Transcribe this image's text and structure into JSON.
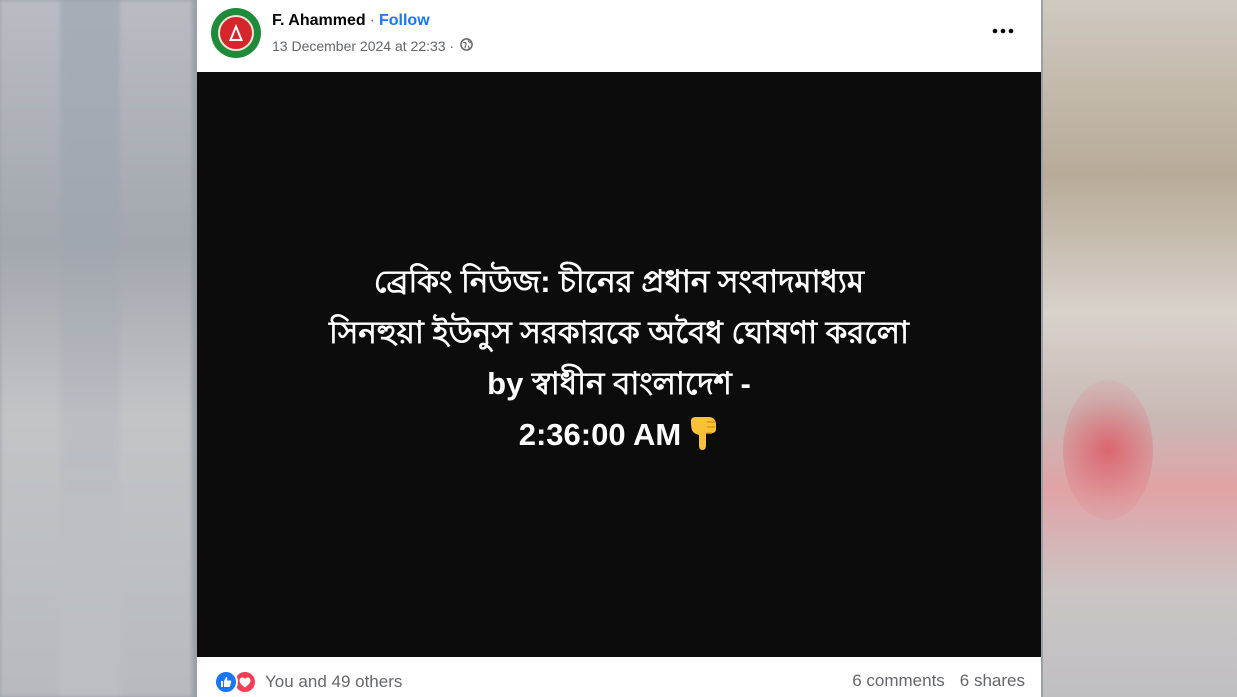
{
  "post": {
    "author": "F. Ahammed",
    "separator": "·",
    "follow_label": "Follow",
    "timestamp": "13 December 2024 at 22:33 ·",
    "audience_icon": "globe-icon",
    "more_icon": "more-options-icon"
  },
  "media": {
    "lines": [
      "ব্রেকিং নিউজ: চীনের প্রধান সংবাদমাধ্যম",
      "সিনহুয়া ইউনুস সরকারকে অবৈধ ঘোষণা করলো",
      "by স্বাধীন বাংলাদেশ -",
      "2:36:00 AM"
    ],
    "emoji_icon": "pointing-down-hand-icon"
  },
  "engagement": {
    "reaction_icons": [
      "like-icon",
      "love-icon"
    ],
    "reactions_label": "You and 49 others",
    "comments_label": "6 comments",
    "shares_label": "6 shares"
  },
  "colors": {
    "link_blue": "#1877f2",
    "secondary_text": "#65676b",
    "media_background": "#0c0c0c",
    "avatar_green": "#1e8b3a",
    "avatar_red": "#d6262d"
  }
}
